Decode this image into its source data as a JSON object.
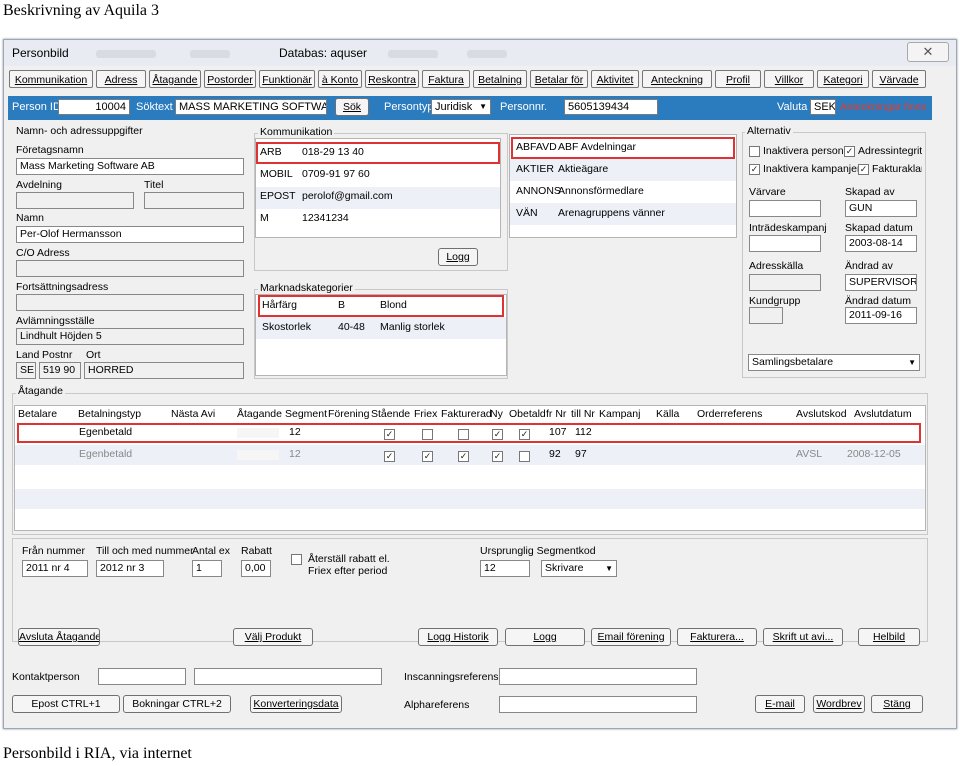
{
  "doc_title": "Beskrivning av Aquila 3",
  "caption": "Personbild i RIA, via internet",
  "window": {
    "title": "Personbild",
    "database_label": "Databas: aquser",
    "close_glyph": "✕"
  },
  "tabs": [
    {
      "label": "Kommunikation"
    },
    {
      "label": "Adress"
    },
    {
      "label": "Åtagande"
    },
    {
      "label": "Postorder"
    },
    {
      "label": "Funktionär"
    },
    {
      "label": "à Konto"
    },
    {
      "label": "Reskontra"
    },
    {
      "label": "Faktura"
    },
    {
      "label": "Betalning"
    },
    {
      "label": "Betalar för"
    },
    {
      "label": "Aktivitet"
    },
    {
      "label": "Anteckning"
    },
    {
      "label": "Profil"
    },
    {
      "label": "Villkor"
    },
    {
      "label": "Kategori"
    },
    {
      "label": "Värvade"
    }
  ],
  "idbar": {
    "person_id_label": "Person ID",
    "person_id_value": "10004",
    "soktext_label": "Söktext",
    "soktext_value": "MASS MARKETING SOFTWARE",
    "sok_button": "Sök",
    "persontyp_label": "Persontyp",
    "persontyp_value": "Juridisk",
    "personnr_label": "Personnr.",
    "personnr_value": "5605139434",
    "valuta_label": "Valuta",
    "valuta_value": "SEK",
    "anteckningar_text": "Anteckningar finns"
  },
  "address": {
    "group_title": "Namn- och adressuppgifter",
    "foretagsnamn_label": "Företagsnamn",
    "foretagsnamn_value": "Mass Marketing Software AB",
    "avdelning_label": "Avdelning",
    "titel_label": "Titel",
    "namn_label": "Namn",
    "namn_value": "Per-Olof Hermansson",
    "co_label": "C/O Adress",
    "fortsattning_label": "Fortsättningsadress",
    "avlamning_label": "Avlämningsställe",
    "avlamning_value": "Lindhult Höjden 5",
    "land_label": "Land",
    "postnr_label": "Postnr",
    "ort_label": "Ort",
    "land_value": "SE",
    "postnr_value": "519 90",
    "ort_value": "HORRED"
  },
  "kommunikation": {
    "group_title": "Kommunikation",
    "rows": [
      {
        "type": "ARB",
        "value": "018-29 13 40"
      },
      {
        "type": "MOBIL",
        "value": "0709-91 97 60"
      },
      {
        "type": "EPOST",
        "value": "perolof@gmail.com"
      },
      {
        "type": "M",
        "value": "12341234"
      }
    ],
    "logg_button": "Logg"
  },
  "marknad": {
    "group_title": "Marknadskategorier",
    "rows": [
      {
        "cat": "Hårfärg",
        "code": "B",
        "desc": "Blond"
      },
      {
        "cat": "Skostorlek",
        "code": "40-48",
        "desc": "Manlig storlek"
      }
    ]
  },
  "kategorier": [
    {
      "code": "ABFAVD",
      "desc": "ABF Avdelningar"
    },
    {
      "code": "AKTIER",
      "desc": "Aktieägare"
    },
    {
      "code": "ANNONS",
      "desc": "Annonsförmedlare"
    },
    {
      "code": "VÄN",
      "desc": "Arenagruppens vänner"
    }
  ],
  "alternativ": {
    "group_title": "Alternativ",
    "chk1": "Inaktivera person",
    "chk2": "Adressintegritet",
    "chk3": "Inaktivera kampanjer",
    "chk4": "Fakturaklar",
    "check_glyph": "✓",
    "varvare_label": "Värvare",
    "skapad_av_label": "Skapad av",
    "skapad_av_value": "GUN",
    "intrade_label": "Inträdeskampanj",
    "skapad_datum_label": "Skapad datum",
    "skapad_datum_value": "2003-08-14",
    "adresskalla_label": "Adresskälla",
    "andrad_av_label": "Ändrad av",
    "andrad_av_value": "SUPERVISOR",
    "kundgrupp_label": "Kundgrupp",
    "andrad_datum_label": "Ändrad datum",
    "andrad_datum_value": "2011-09-16",
    "samlings_value": "Samlingsbetalare",
    "dropdown_glyph": "▼"
  },
  "atagande": {
    "group_title": "Åtagande",
    "headers": [
      "Betalare",
      "Betalningstyp",
      "Nästa Avi",
      "Åtagande",
      "Segment",
      "Förening",
      "Stående",
      "Friex",
      "Fakturerad",
      "Ny",
      "Obetald",
      "fr Nr",
      "till Nr",
      "Kampanj",
      "Källa",
      "Orderreferens",
      "Avslutskod",
      "Avslutdatum"
    ],
    "rows": [
      {
        "typ": "Egenbetald",
        "segment": "12",
        "fr": "107",
        "till": "112",
        "avslutskod": "",
        "avslutdatum": ""
      },
      {
        "typ": "Egenbetald",
        "segment": "12",
        "fr": "92",
        "till": "97",
        "avslutskod": "AVSL",
        "avslutdatum": "2008-12-05"
      }
    ]
  },
  "bottom": {
    "fran_label": "Från nummer",
    "fran_value": "2011 nr 4",
    "till_label": "Till och med nummer",
    "till_value": "2012 nr 3",
    "antal_label": "Antal ex",
    "antal_value": "1",
    "rabatt_label": "Rabatt",
    "rabatt_value": "0,00",
    "aterstall_label": "Återställ rabatt el.",
    "aterstall_label2": "Friex efter period",
    "urspr_label": "Ursprunglig Segmentkod",
    "urspr_value": "12",
    "skrivare_value": "Skrivare"
  },
  "buttons": {
    "avsluta": "Avsluta Åtagande",
    "valj": "Välj Produkt",
    "logg_historik": "Logg Historik",
    "logg": "Logg",
    "email_forening": "Email förening",
    "fakturera": "Fakturera...",
    "skrift": "Skrift ut avi...",
    "helbild": "Helbild",
    "epost": "Epost CTRL+1",
    "bokningar": "Bokningar CTRL+2",
    "konvertering": "Konverteringsdata",
    "email": "E-mail",
    "wordbrev": "Wordbrev",
    "stang": "Stäng"
  },
  "footer": {
    "kontakt_label": "Kontaktperson",
    "inscanning_label": "Inscanningsreferens",
    "alpha_label": "Alphareferens"
  }
}
